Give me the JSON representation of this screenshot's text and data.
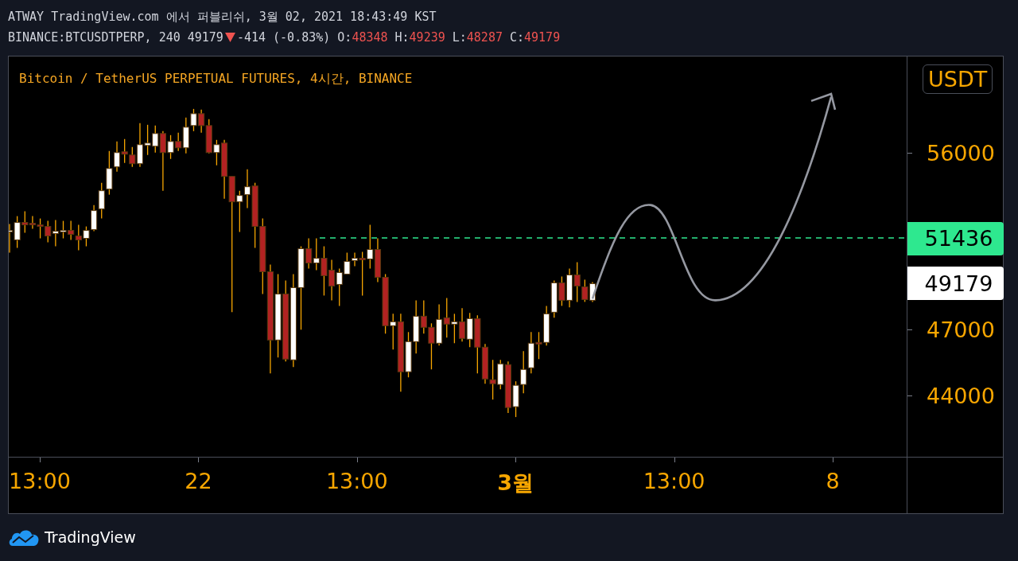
{
  "header": {
    "published": "ATWAY TradingView.com 에서 퍼블리쉬, 3월 02, 2021 18:43:49 KST",
    "symbol": "BINANCE:BTCUSDTPERP, 240",
    "price": "49179",
    "falling": true,
    "change": "-414 (-0.83%)",
    "ohlc": [
      {
        "label": "O:",
        "value": "48348"
      },
      {
        "label": "H:",
        "value": "49239"
      },
      {
        "label": "L:",
        "value": "48287"
      },
      {
        "label": "C:",
        "value": "49179"
      }
    ]
  },
  "chart": {
    "legend": "Bitcoin / TetherUS PERPETUAL FUTURES, 4시간, BINANCE",
    "currency": "USDT",
    "price_ticks": [
      "56000",
      "47000",
      "44000"
    ],
    "price_markers": [
      {
        "text": "51436",
        "kind": "line",
        "color": "#2ee88f"
      },
      {
        "text": "49179",
        "kind": "last",
        "color": "#ffffff"
      }
    ],
    "time_labels": [
      {
        "text": "13:00",
        "bold": false
      },
      {
        "text": "22",
        "bold": false
      },
      {
        "text": "13:00",
        "bold": false
      },
      {
        "text": "3월",
        "bold": true
      },
      {
        "text": "13:00",
        "bold": false
      },
      {
        "text": "8",
        "bold": false
      }
    ]
  },
  "footer": {
    "brand": "TradingView"
  }
}
